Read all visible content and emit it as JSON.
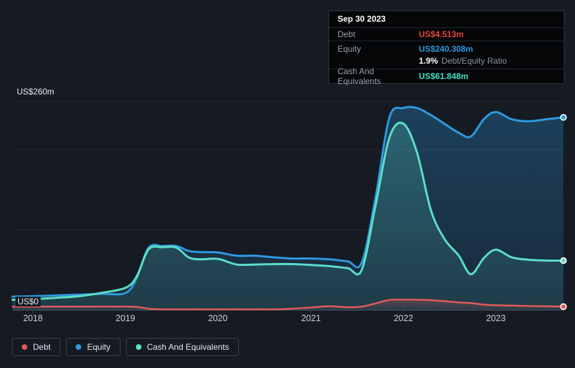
{
  "tooltip": {
    "date": "Sep 30 2023",
    "debt_label": "Debt",
    "debt_value": "US$4.513m",
    "equity_label": "Equity",
    "equity_value": "US$240.308m",
    "ratio_value": "1.9%",
    "ratio_label": "Debt/Equity Ratio",
    "cash_label": "Cash And Equivalents",
    "cash_value": "US$61.848m"
  },
  "axis": {
    "y_top_label": "US$260m",
    "y_zero_label": "US$0",
    "x_labels": [
      "2018",
      "2019",
      "2020",
      "2021",
      "2022",
      "2023"
    ]
  },
  "legend": [
    {
      "label": "Debt",
      "color": "#E05A5A"
    },
    {
      "label": "Equity",
      "color": "#2F99E0"
    },
    {
      "label": "Cash And Equivalents",
      "color": "#5CDEC6"
    }
  ],
  "colors": {
    "background": "#151A23",
    "tooltip_bg": "#040608",
    "grid": "#242B35",
    "axis_line": "#39414C",
    "debt": "#E05A5A",
    "equity": "#2F99E0",
    "cash": "#5CDEC6"
  },
  "chart_data": {
    "type": "area",
    "title": "Debt to Equity History",
    "unit": "US$ millions",
    "ylim": [
      0,
      260
    ],
    "grid_values": [
      100,
      200,
      260
    ],
    "x_tick_years": [
      2018,
      2019,
      2020,
      2021,
      2022,
      2023
    ],
    "x_tick_labels": [
      "2018",
      "2019",
      "2020",
      "2021",
      "2022",
      "2023"
    ],
    "legend_position": "bottom-left",
    "last_point": {
      "date": "Sep 30 2023",
      "debt": 4.513,
      "equity": 240.308,
      "cash": 61.848,
      "debt_equity_ratio_pct": 1.9
    },
    "x": [
      2017.78,
      2018.0,
      2018.25,
      2018.5,
      2018.75,
      2019.0,
      2019.12,
      2019.25,
      2019.4,
      2019.55,
      2019.68,
      2019.8,
      2020.0,
      2020.2,
      2020.4,
      2020.6,
      2020.8,
      2021.0,
      2021.2,
      2021.4,
      2021.55,
      2021.7,
      2021.85,
      2022.0,
      2022.15,
      2022.3,
      2022.45,
      2022.6,
      2022.73,
      2022.87,
      2023.0,
      2023.17,
      2023.35,
      2023.55,
      2023.73
    ],
    "series": [
      {
        "name": "Equity",
        "color": "#2F99E0",
        "values": [
          17.0,
          17.5,
          18.5,
          19.5,
          20.5,
          21.5,
          40,
          78,
          80,
          80,
          74,
          72.5,
          72,
          68,
          68,
          66,
          64.5,
          64.5,
          63.5,
          61,
          59,
          140,
          240,
          252,
          252,
          243,
          232,
          221,
          216.5,
          238,
          247,
          238,
          235.5,
          238,
          240.308
        ]
      },
      {
        "name": "Cash And Equivalents",
        "color": "#5CDEC6",
        "values": [
          13.0,
          14.0,
          15.5,
          17.5,
          22,
          28,
          42,
          76,
          78.5,
          78,
          66,
          63.5,
          64,
          57,
          57,
          57.5,
          57.5,
          56.5,
          55,
          52.5,
          50,
          130,
          215,
          232.6,
          196,
          124,
          88,
          68,
          45,
          65,
          75.5,
          66,
          63,
          62,
          61.848
        ]
      },
      {
        "name": "Debt",
        "color": "#E05A5A",
        "values": [
          4.6,
          4.6,
          4.6,
          4.6,
          4.7,
          4.7,
          4.2,
          2.0,
          1.2,
          1.2,
          1.2,
          1.2,
          1.2,
          1.2,
          1.2,
          1.2,
          2.0,
          3.5,
          5.0,
          3.8,
          4.5,
          8.5,
          12.8,
          13.3,
          13.2,
          12.6,
          11.3,
          9.8,
          8.9,
          7.0,
          6.3,
          5.8,
          5.3,
          5.0,
          4.513
        ]
      }
    ]
  }
}
